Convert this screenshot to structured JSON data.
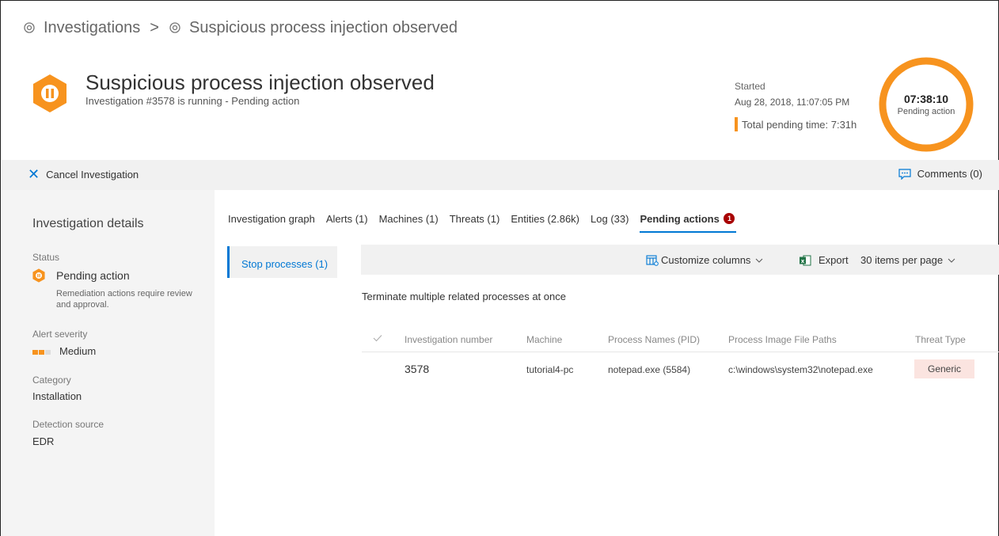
{
  "breadcrumb": {
    "items": [
      "Investigations",
      "Suspicious process injection observed"
    ],
    "separator": ">"
  },
  "header": {
    "title": "Suspicious process injection observed",
    "subtitle": "Investigation #3578 is running - Pending action",
    "started_label": "Started",
    "started_value": "Aug 28, 2018, 11:07:05 PM",
    "pending_time": "Total pending time: 7:31h",
    "timer": "07:38:10",
    "timer_status": "Pending action",
    "icon": "investigation-pause-icon",
    "accent_color": "#f7931e"
  },
  "commandbar": {
    "cancel_label": "Cancel Investigation",
    "comments_label": "Comments (0)"
  },
  "details": {
    "title": "Investigation details",
    "status_label": "Status",
    "status_value": "Pending action",
    "status_desc": "Remediation actions require review and approval.",
    "severity_label": "Alert severity",
    "severity_value": "Medium",
    "category_label": "Category",
    "category_value": "Installation",
    "source_label": "Detection source",
    "source_value": "EDR"
  },
  "tabs": [
    {
      "label": "Investigation graph"
    },
    {
      "label": "Alerts (1)"
    },
    {
      "label": "Machines (1)"
    },
    {
      "label": "Threats (1)"
    },
    {
      "label": "Entities (2.86k)"
    },
    {
      "label": "Log (33)"
    },
    {
      "label": "Pending actions",
      "badge": "1",
      "active": true
    }
  ],
  "subnav": {
    "label": "Stop processes (1)"
  },
  "toolbar": {
    "customize_label": "Customize columns",
    "export_label": "Export",
    "per_page_label": "30 items per page"
  },
  "action_desc": "Terminate multiple related processes at once",
  "table": {
    "columns": [
      "Investigation number",
      "Machine",
      "Process Names (PID)",
      "Process Image File Paths",
      "Threat Type"
    ],
    "rows": [
      [
        "3578",
        "tutorial4-pc",
        "notepad.exe (5584)",
        "c:\\windows\\system32\\notepad.exe",
        "Generic"
      ]
    ]
  },
  "colors": {
    "accent_blue": "#0078d4",
    "orange": "#f7931e",
    "badge_red": "#a80000",
    "threat_bg": "#fbe4e0"
  }
}
